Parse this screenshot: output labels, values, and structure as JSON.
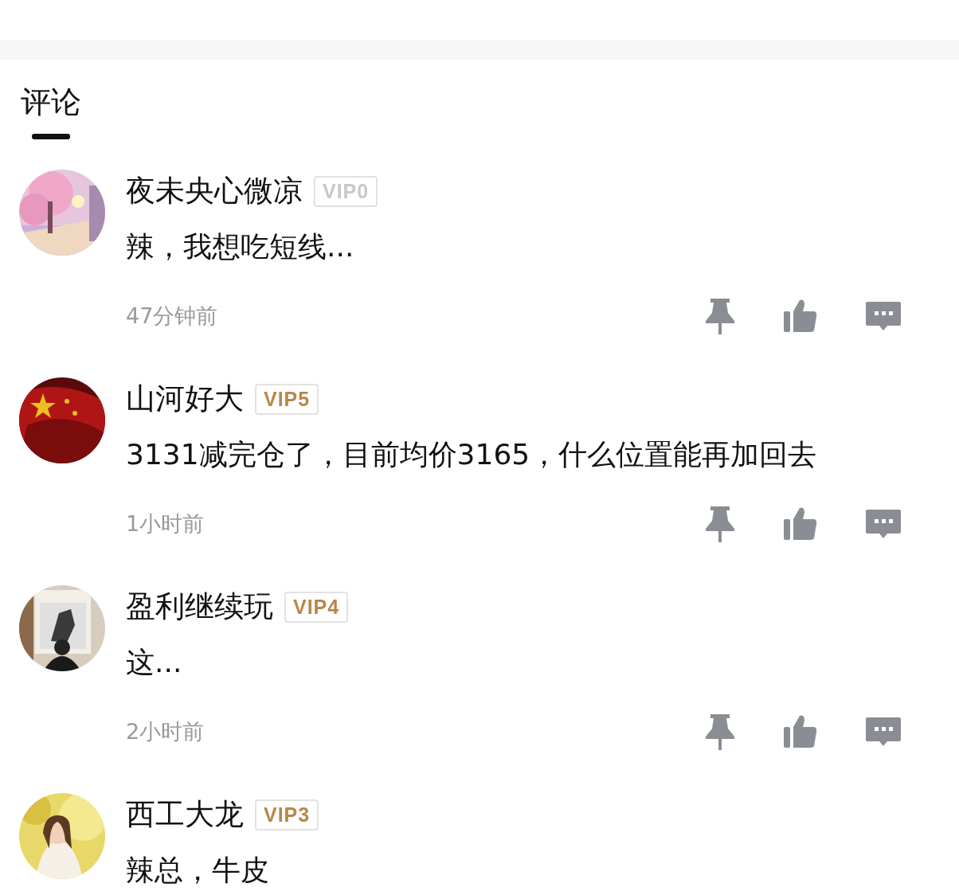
{
  "section": {
    "title": "评论",
    "selected": true
  },
  "comments": [
    {
      "user": "夜未央心微凉",
      "vip": {
        "label": "VIP0",
        "color": "#c8c8c8"
      },
      "text": "辣，我想吃短线...",
      "time": "47分钟前"
    },
    {
      "user": "山河好大",
      "vip": {
        "label": "VIP5",
        "color": "#b8874a"
      },
      "text": "3131减完仓了，目前均价3165，什么位置能再加回去",
      "time": "1小时前"
    },
    {
      "user": "盈利继续玩",
      "vip": {
        "label": "VIP4",
        "color": "#b8874a"
      },
      "text": "这...",
      "time": "2小时前"
    },
    {
      "user": "西工大龙",
      "vip": {
        "label": "VIP3",
        "color": "#b8874a"
      },
      "text": "辣总，牛皮"
    }
  ]
}
